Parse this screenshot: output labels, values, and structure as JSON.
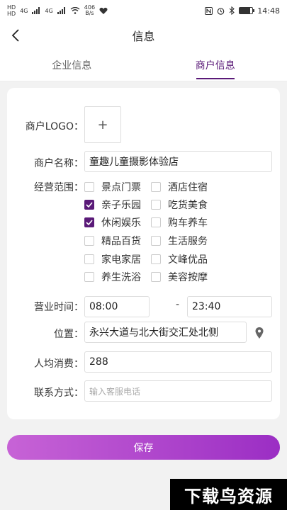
{
  "status_bar": {
    "hd1": "HD",
    "hd2": "HD",
    "signal1": "4G",
    "signal2": "4G",
    "net_speed": "406",
    "net_unit": "B/s",
    "time": "14:48"
  },
  "nav": {
    "title": "信息"
  },
  "tabs": [
    {
      "label": "企业信息",
      "active": false
    },
    {
      "label": "商户信息",
      "active": true
    }
  ],
  "form": {
    "logo_label": "商户LOGO：",
    "logo_plus": "+",
    "name_label": "商户名称：",
    "name_value": "童趣儿童摄影体验店",
    "scope_label": "经营范围：",
    "scope_items": [
      {
        "label": "景点门票",
        "checked": false
      },
      {
        "label": "酒店住宿",
        "checked": false
      },
      {
        "label": "亲子乐园",
        "checked": true
      },
      {
        "label": "吃货美食",
        "checked": false
      },
      {
        "label": "休闲娱乐",
        "checked": true
      },
      {
        "label": "购车养车",
        "checked": false
      },
      {
        "label": "精品百货",
        "checked": false
      },
      {
        "label": "生活服务",
        "checked": false
      },
      {
        "label": "家电家居",
        "checked": false
      },
      {
        "label": "文峰优品",
        "checked": false
      },
      {
        "label": "养生洗浴",
        "checked": false
      },
      {
        "label": "美容按摩",
        "checked": false
      }
    ],
    "hours_label": "营业时间：",
    "open_time": "08:00",
    "time_dash": "-",
    "close_time": "23:40",
    "location_label": "位置：",
    "location_value": "永兴大道与北大街交汇处北侧",
    "avg_label": "人均消费：",
    "avg_value": "288",
    "contact_label": "联系方式：",
    "contact_placeholder": "输入客服电话"
  },
  "save_label": "保存",
  "watermark": "下载鸟资源",
  "colors": {
    "accent": "#5a1a78",
    "button_start": "#c763d6",
    "button_end": "#9b2ec4"
  }
}
